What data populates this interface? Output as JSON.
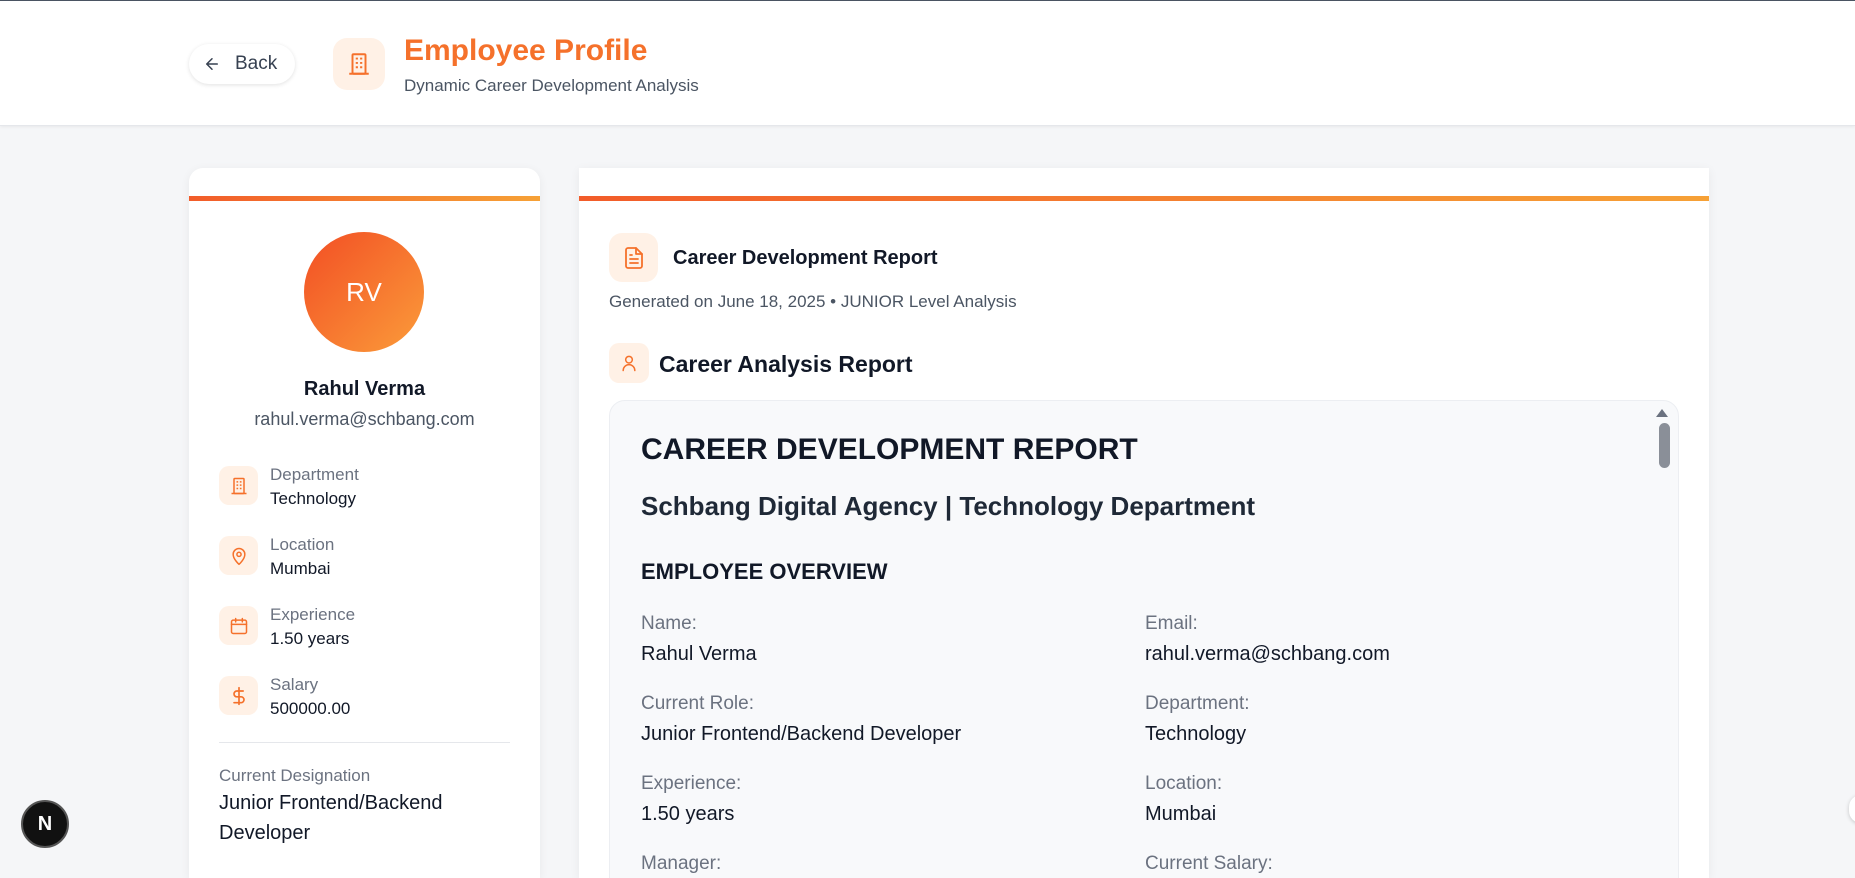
{
  "header": {
    "back_label": "Back",
    "title": "Employee Profile",
    "subtitle": "Dynamic Career Development Analysis",
    "accent_color": "#f5712b"
  },
  "profile": {
    "initials": "RV",
    "name": "Rahul Verma",
    "email": "rahul.verma@schbang.com",
    "fields": [
      {
        "label": "Department",
        "value": "Technology",
        "icon": "building-icon"
      },
      {
        "label": "Location",
        "value": "Mumbai",
        "icon": "map-pin-icon"
      },
      {
        "label": "Experience",
        "value": "1.50 years",
        "icon": "calendar-icon"
      },
      {
        "label": "Salary",
        "value": "500000.00",
        "icon": "dollar-icon"
      }
    ],
    "designation_label": "Current Designation",
    "designation_value": "Junior Frontend/Backend Developer"
  },
  "report": {
    "title": "Career Development Report",
    "meta": "Generated on June 18, 2025 • JUNIOR Level Analysis",
    "section_title": "Career Analysis Report",
    "doc": {
      "h1": "CAREER DEVELOPMENT REPORT",
      "h2": "Schbang Digital Agency | Technology Department",
      "h3": "EMPLOYEE OVERVIEW",
      "fields": [
        {
          "label": "Name:",
          "value": "Rahul Verma"
        },
        {
          "label": "Email:",
          "value": "rahul.verma@schbang.com"
        },
        {
          "label": "Current Role:",
          "value": "Junior Frontend/Backend Developer"
        },
        {
          "label": "Department:",
          "value": "Technology"
        },
        {
          "label": "Experience:",
          "value": "1.50 years"
        },
        {
          "label": "Location:",
          "value": "Mumbai"
        },
        {
          "label": "Manager:",
          "value": ""
        },
        {
          "label": "Current Salary:",
          "value": ""
        }
      ]
    }
  },
  "badge": {
    "letter": "N"
  }
}
